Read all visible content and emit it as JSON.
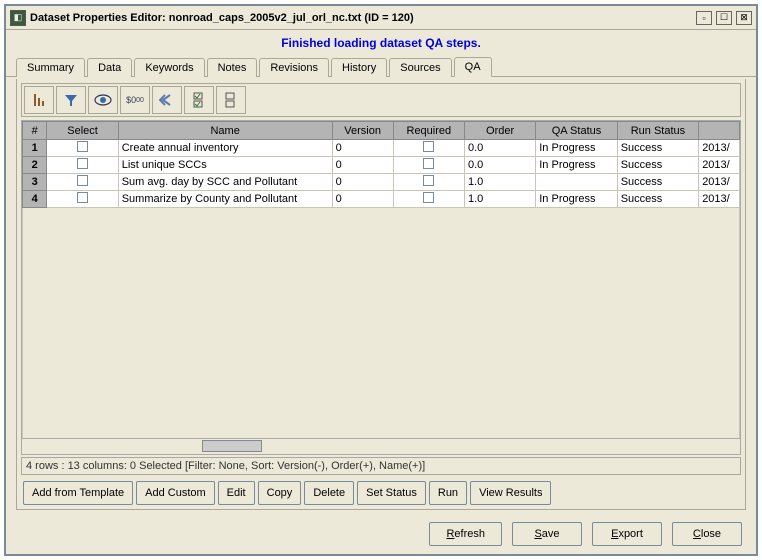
{
  "window": {
    "title": "Dataset Properties Editor: nonroad_caps_2005v2_jul_orl_nc.txt (ID = 120)"
  },
  "status_message": "Finished loading dataset QA steps.",
  "tabs": {
    "summary": "Summary",
    "data": "Data",
    "keywords": "Keywords",
    "notes": "Notes",
    "revisions": "Revisions",
    "history": "History",
    "sources": "Sources",
    "qa": "QA"
  },
  "table": {
    "headers": {
      "num": "#",
      "select": "Select",
      "name": "Name",
      "version": "Version",
      "required": "Required",
      "order": "Order",
      "qa_status": "QA Status",
      "run_status": "Run Status",
      "date": ""
    },
    "rows": [
      {
        "num": "1",
        "name": "Create annual inventory",
        "version": "0",
        "order": "0.0",
        "qa_status": "In Progress",
        "run_status": "Success",
        "date": "2013/"
      },
      {
        "num": "2",
        "name": "List unique SCCs",
        "version": "0",
        "order": "0.0",
        "qa_status": "In Progress",
        "run_status": "Success",
        "date": "2013/"
      },
      {
        "num": "3",
        "name": "Sum avg. day by SCC and Pollutant",
        "version": "0",
        "order": "1.0",
        "qa_status": "",
        "run_status": "Success",
        "date": "2013/"
      },
      {
        "num": "4",
        "name": "Summarize by County and Pollutant",
        "version": "0",
        "order": "1.0",
        "qa_status": "In Progress",
        "run_status": "Success",
        "date": "2013/"
      }
    ]
  },
  "status_bar": "4 rows : 13 columns: 0 Selected [Filter: None, Sort: Version(-), Order(+), Name(+)]",
  "buttons": {
    "add_from_template": "Add from Template",
    "add_custom": "Add Custom",
    "edit": "Edit",
    "copy": "Copy",
    "delete": "Delete",
    "set_status": "Set Status",
    "run": "Run",
    "view_results": "View Results",
    "refresh": "Refresh",
    "save": "Save",
    "export": "Export",
    "close": "Close"
  },
  "accent_color": "#7a8a99"
}
